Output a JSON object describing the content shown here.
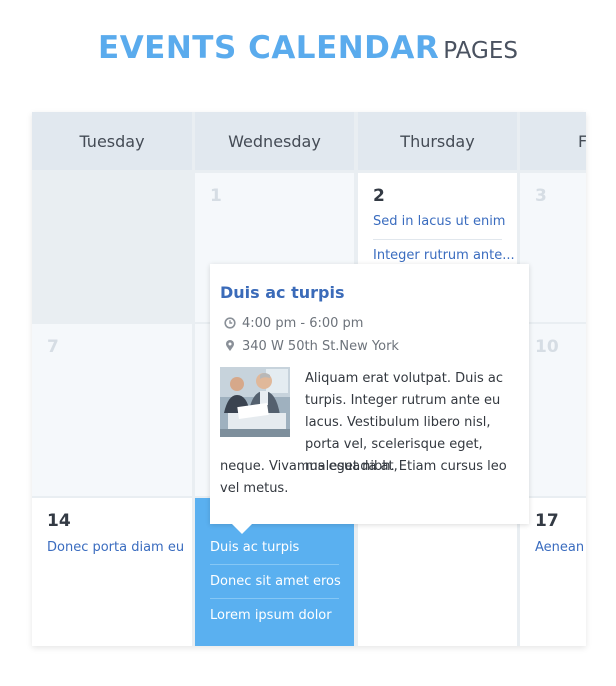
{
  "header": {
    "title_main": "EVENTS CALENDAR",
    "title_sub": "PAGES"
  },
  "calendar": {
    "weekdays": [
      "Tuesday",
      "Wednesday",
      "Thursday",
      "F"
    ],
    "row1": {
      "wed_num": "1",
      "thu_num": "2",
      "thu_events": [
        "Sed in lacus ut enim",
        "Integer rutrum ante..."
      ],
      "fri_num": "3"
    },
    "row2": {
      "tue_num": "7",
      "fri_num": "10"
    },
    "row3": {
      "tue_num": "14",
      "tue_events": [
        "Donec porta diam eu"
      ],
      "wed_events": [
        "Duis ac turpis",
        "Donec sit amet eros",
        "Lorem ipsum dolor"
      ],
      "fri_num": "17",
      "fri_events": [
        "Aenean a"
      ]
    }
  },
  "popup": {
    "title": "Duis ac turpis",
    "time": "4:00 pm - 6:00 pm",
    "location": "340 W 50th St.New York",
    "description_top": "Aliquam erat volutpat. Duis ac turpis. Integer rutrum ante eu lacus. Vestibulum libero nisl, porta vel, scelerisque eget, malesuada at,",
    "description_bottom": "neque. Vivamus eget nibh. Etiam cursus leo vel metus.",
    "time_icon": "clock-icon",
    "location_icon": "map-pin-icon"
  },
  "colors": {
    "title_accent": "#5aabed",
    "event_link": "#3a6cbf",
    "highlight_day": "#5ab0f0",
    "header_bg": "#e1e8ef"
  }
}
